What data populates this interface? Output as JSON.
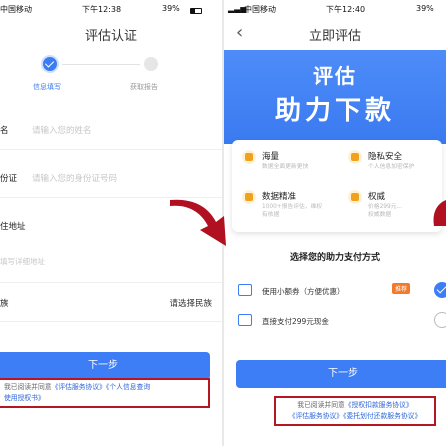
{
  "left": {
    "status": {
      "carrier": "中国移动",
      "time": "下午12:38",
      "battery": "39%"
    },
    "title": "评估认证",
    "steps": [
      {
        "label": "信息填写",
        "active": true
      },
      {
        "label": "获取报告",
        "active": false
      }
    ],
    "form": {
      "name_label": "名",
      "name_placeholder": "请输入您的姓名",
      "id_label": "份证",
      "id_placeholder": "请输入您的身份证号码",
      "address_label": "住地址",
      "address_placeholder": "填写详细地址",
      "ethnic_label": "族",
      "ethnic_select": "请选择民族"
    },
    "next_button": "下一步",
    "agreement": {
      "prefix": "我已阅读并同意",
      "link1": "《评估服务协议》",
      "link2": "《个人信息查询",
      "link3": "使用授权书》"
    }
  },
  "right": {
    "status": {
      "carrier": "中国移动",
      "time": "下午12:40",
      "battery": "39%"
    },
    "title": "立即评估",
    "hero": {
      "line1": "评估",
      "line2": "助力下款"
    },
    "features": [
      {
        "title": "海量",
        "sub": "数据全面更新更快"
      },
      {
        "title": "隐私安全",
        "sub": "个人信息加密保护"
      },
      {
        "title": "数据精准",
        "sub": "1000+报告评估，维权",
        "sub2": "有依据"
      },
      {
        "title": "权威",
        "sub": "价格299元...",
        "sub2": "权威数据"
      }
    ],
    "pay_title": "选择您的助力支付方式",
    "pay_options": [
      {
        "label": "使用小额券（方便优惠）",
        "tag": "推荐",
        "selected": true
      },
      {
        "label": "直接支付299元现金",
        "selected": false
      }
    ],
    "next_button": "下一步",
    "agreement": {
      "prefix": "我已阅读并同意",
      "link1": "《授权扣款服务协议》",
      "link2": "《评估服务协议》",
      "link3": "《委托划付还款服务协议》"
    }
  },
  "colors": {
    "primary": "#3d7df5",
    "highlight_border": "#b41622",
    "arrow": "#b01020",
    "tag": "#f37a2a"
  }
}
